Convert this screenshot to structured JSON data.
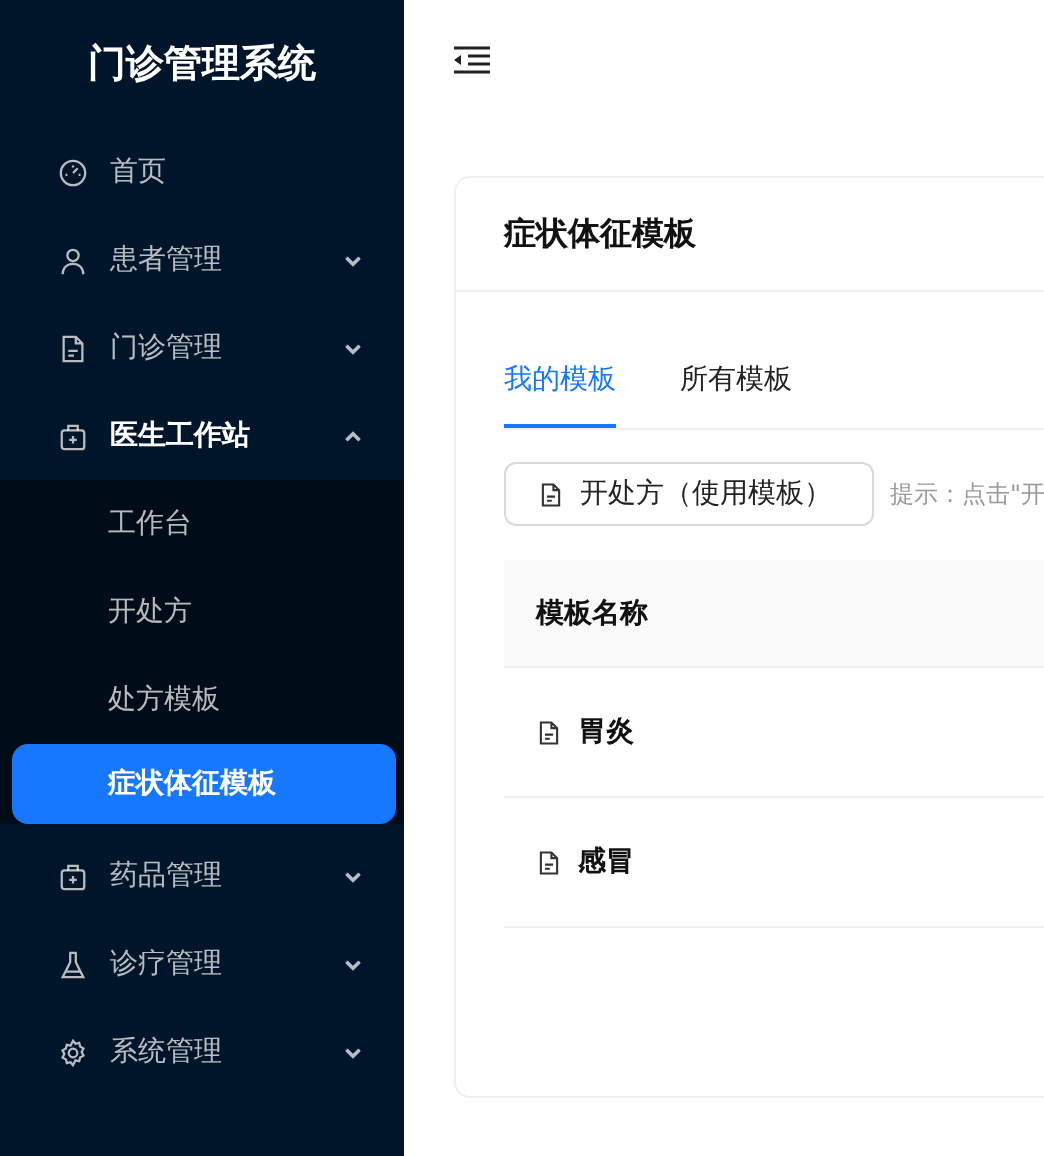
{
  "sidebar": {
    "title": "门诊管理系统",
    "items": [
      {
        "label": "首页"
      },
      {
        "label": "患者管理",
        "expanded": false
      },
      {
        "label": "门诊管理",
        "expanded": false
      },
      {
        "label": "医生工作站",
        "expanded": true,
        "children": [
          {
            "label": "工作台",
            "selected": false
          },
          {
            "label": "开处方",
            "selected": false
          },
          {
            "label": "处方模板",
            "selected": false
          },
          {
            "label": "症状体征模板",
            "selected": true
          }
        ]
      },
      {
        "label": "药品管理",
        "expanded": false
      },
      {
        "label": "诊疗管理",
        "expanded": false
      },
      {
        "label": "系统管理",
        "expanded": false
      }
    ]
  },
  "card": {
    "title": "症状体征模板",
    "tabs": [
      {
        "label": "我的模板",
        "selected": true
      },
      {
        "label": "所有模板",
        "selected": false
      }
    ],
    "button": "开处方（使用模板）",
    "hint": "提示：点击\"开",
    "table": {
      "columns": [
        "模板名称"
      ],
      "rows": [
        [
          "胃炎"
        ],
        [
          "感冒"
        ]
      ]
    }
  }
}
